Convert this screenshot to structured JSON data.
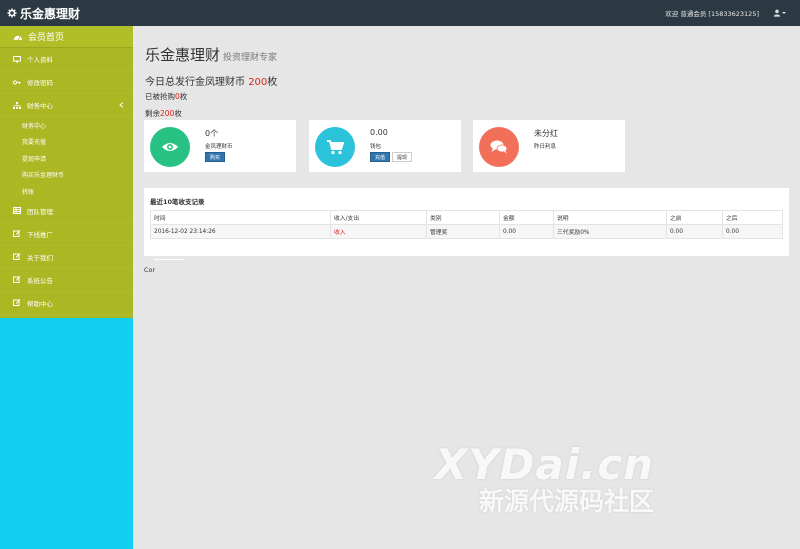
{
  "header": {
    "brand": "乐金惠理财",
    "welcome": "欢迎 普通会员 [15833623125]"
  },
  "sidebar": {
    "home": "会员首页",
    "items": [
      {
        "label": "个人资料",
        "icon": "monitor-icon"
      },
      {
        "label": "修改密码",
        "icon": "key-icon"
      },
      {
        "label": "财务中心",
        "icon": "sitemap-icon",
        "expanded": true
      }
    ],
    "sub_items": [
      "财务中心",
      "我要充值",
      "提现申请",
      "购买乐金理财币",
      "转账"
    ],
    "items_after": [
      {
        "label": "团队管理",
        "icon": "table-icon"
      },
      {
        "label": "下线推广",
        "icon": "edit-icon"
      },
      {
        "label": "关于我们",
        "icon": "edit-icon"
      },
      {
        "label": "系统公告",
        "icon": "edit-icon"
      },
      {
        "label": "帮助中心",
        "icon": "edit-icon"
      }
    ]
  },
  "main": {
    "title": "乐金惠理财",
    "subtitle": "投资理财专家",
    "issued_prefix": "今日总发行金凤理财币",
    "issued_value": "200",
    "issued_unit": "枚",
    "bought_prefix": "已被抢购",
    "bought_value": "0",
    "bought_unit": "枚",
    "left_prefix": "剩余",
    "left_value": "200",
    "left_unit": "枚"
  },
  "cards": [
    {
      "number": "0个",
      "label": "金凤理财币",
      "buttons": [
        "购买"
      ],
      "color": "#27c283",
      "icon": "eye-icon"
    },
    {
      "number": "0.00",
      "label": "钱包",
      "buttons": [
        "充值",
        "提现"
      ],
      "color": "#2bc3da",
      "icon": "cart-icon"
    },
    {
      "number": "未分红",
      "label": "昨日利息",
      "buttons": [],
      "color": "#f2705a",
      "icon": "chat-icon"
    }
  ],
  "transactions": {
    "title": "最近10笔收支记录",
    "columns": [
      "时间",
      "收入/支出",
      "类别",
      "金额",
      "说明",
      "之前",
      "之后"
    ],
    "rows": [
      [
        "2016-12-02 23:14:26",
        "收入",
        "管理奖",
        "0.00",
        "三代奖励0%",
        "0.00",
        "0.00"
      ]
    ]
  },
  "footer": {
    "text": "Cor"
  },
  "watermark": {
    "main": "XYDai.cn",
    "sub": "新源代源码社区"
  }
}
